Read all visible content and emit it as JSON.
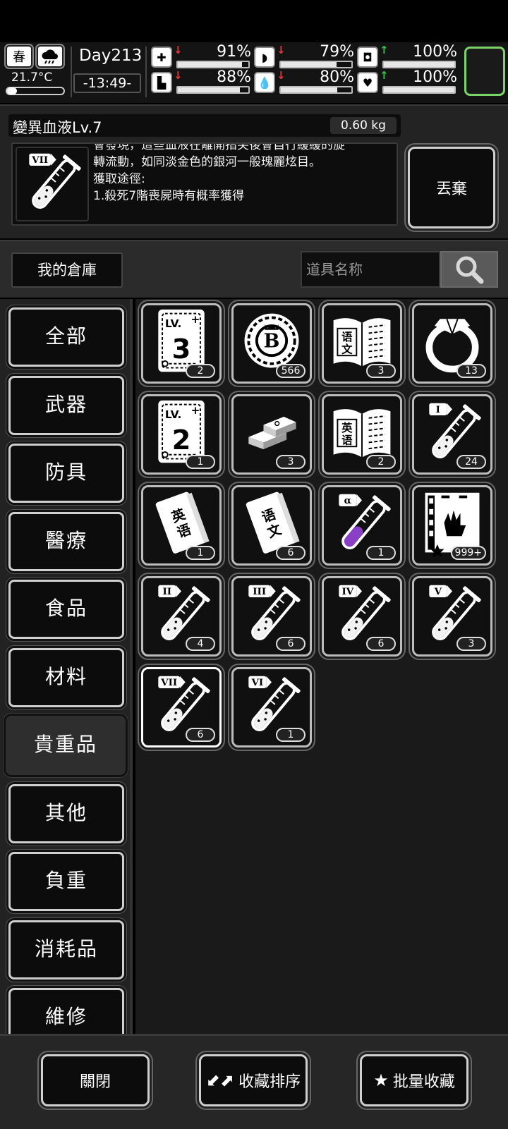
{
  "hud": {
    "season": "春",
    "temperature": "21.7°C",
    "day": "Day213",
    "time": "-13:49-",
    "stats": [
      {
        "name": "health",
        "icon": "medkit-icon",
        "glyph": "✚",
        "trend": "down",
        "value": "91%",
        "level": 0.91
      },
      {
        "name": "hunger",
        "icon": "stomach-icon",
        "glyph": "◗",
        "trend": "down",
        "value": "79%",
        "level": 0.79
      },
      {
        "name": "fatigue",
        "icon": "capsule-icon",
        "glyph": "◘",
        "trend": "up",
        "value": "100%",
        "level": 1.0
      },
      {
        "name": "stamina",
        "icon": "boot-icon",
        "glyph": "▙",
        "trend": "down",
        "value": "88%",
        "level": 0.88
      },
      {
        "name": "thirst",
        "icon": "water-drop-icon",
        "glyph": "💧",
        "trend": "down",
        "value": "80%",
        "level": 0.8
      },
      {
        "name": "mood",
        "icon": "heart-icon",
        "glyph": "♥",
        "trend": "up",
        "value": "100%",
        "level": 1.0
      }
    ]
  },
  "detail": {
    "title": "變異血液Lv.7",
    "weight": "0.60 kg",
    "badge": "VII",
    "desc_lines": [
      "會發現，這些血液在離開指尖後會自行緩緩的旋",
      "轉流動，如同淡金色的銀河一般瑰麗炫目。",
      "獲取途徑:",
      "1.殺死7階喪屍時有概率獲得"
    ],
    "drop_label": "丟棄"
  },
  "warehouse": {
    "label": "我的倉庫",
    "search_placeholder": "道具名称"
  },
  "categories": [
    "全部",
    "武器",
    "防具",
    "醫療",
    "食品",
    "材料",
    "貴重品",
    "其他",
    "負重",
    "消耗品",
    "維修"
  ],
  "active_category": "貴重品",
  "items": [
    {
      "name": "lv3-card",
      "count": "2",
      "kind": "card",
      "label": "3"
    },
    {
      "name": "b-coin",
      "count": "566",
      "kind": "coin"
    },
    {
      "name": "chinese-book-open",
      "count": "3",
      "kind": "openbook",
      "label": "语文"
    },
    {
      "name": "ring",
      "count": "13",
      "kind": "ring"
    },
    {
      "name": "lv2-card",
      "count": "1",
      "kind": "card",
      "label": "2"
    },
    {
      "name": "gold-bars",
      "count": "3",
      "kind": "bars"
    },
    {
      "name": "english-book-open",
      "count": "2",
      "kind": "openbook",
      "label": "英语"
    },
    {
      "name": "blood-vial-1",
      "count": "24",
      "kind": "vial",
      "badge": "I"
    },
    {
      "name": "english-book",
      "count": "1",
      "kind": "book",
      "label": "英语"
    },
    {
      "name": "chinese-book",
      "count": "6",
      "kind": "book",
      "label": "语文"
    },
    {
      "name": "blood-vial-alpha",
      "count": "1",
      "kind": "vial",
      "badge": "α",
      "purple": true
    },
    {
      "name": "zombie-card",
      "count": "999+",
      "kind": "zombie"
    },
    {
      "name": "blood-vial-2",
      "count": "4",
      "kind": "vial",
      "badge": "II"
    },
    {
      "name": "blood-vial-3",
      "count": "6",
      "kind": "vial",
      "badge": "III"
    },
    {
      "name": "blood-vial-4",
      "count": "6",
      "kind": "vial",
      "badge": "IV"
    },
    {
      "name": "blood-vial-5",
      "count": "3",
      "kind": "vial",
      "badge": "V"
    },
    {
      "name": "blood-vial-7",
      "count": "6",
      "kind": "vial",
      "badge": "VII",
      "selected": true
    },
    {
      "name": "blood-vial-6",
      "count": "1",
      "kind": "vial",
      "badge": "VI"
    }
  ],
  "bottom": {
    "close_label": "關閉",
    "sort_label": "收藏排序",
    "batch_label": "批量收藏"
  },
  "colors": {
    "accent_green": "#7bd36a",
    "trend_down": "#e23a3a",
    "trend_up": "#38c24a",
    "alpha_fluid": "#8a3fc7"
  }
}
